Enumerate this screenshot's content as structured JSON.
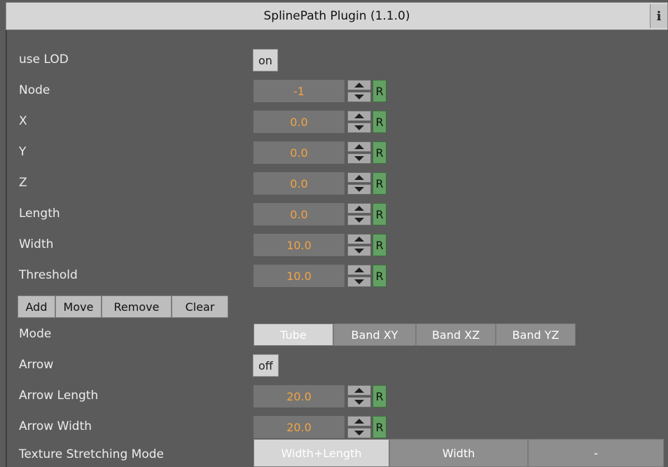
{
  "title": "SplinePath Plugin (1.1.0)",
  "info_label": "i",
  "use_lod": {
    "label": "use LOD",
    "value": "on"
  },
  "fields": [
    {
      "label": "Node",
      "value": "-1",
      "reset": "R"
    },
    {
      "label": "X",
      "value": "0.0",
      "reset": "R"
    },
    {
      "label": "Y",
      "value": "0.0",
      "reset": "R"
    },
    {
      "label": "Z",
      "value": "0.0",
      "reset": "R"
    },
    {
      "label": "Length",
      "value": "0.0",
      "reset": "R"
    },
    {
      "label": "Width",
      "value": "10.0",
      "reset": "R"
    },
    {
      "label": "Threshold",
      "value": "10.0",
      "reset": "R"
    }
  ],
  "commands": [
    "Add",
    "Move",
    "Remove",
    "Clear"
  ],
  "mode": {
    "label": "Mode",
    "options": [
      "Tube",
      "Band XY",
      "Band XZ",
      "Band YZ"
    ],
    "selected": "Tube"
  },
  "arrow": {
    "label": "Arrow",
    "value": "off"
  },
  "arrow_length": {
    "label": "Arrow Length",
    "value": "20.0",
    "reset": "R"
  },
  "arrow_width": {
    "label": "Arrow Width",
    "value": "20.0",
    "reset": "R"
  },
  "texture_mode": {
    "label": "Texture Stretching Mode",
    "options": [
      "Width+Length",
      "Width",
      "-"
    ],
    "selected": "Width+Length"
  },
  "colors": {
    "value_text": "#f2a444",
    "reset_button": "#63a063",
    "background": "#5b5b5b"
  }
}
